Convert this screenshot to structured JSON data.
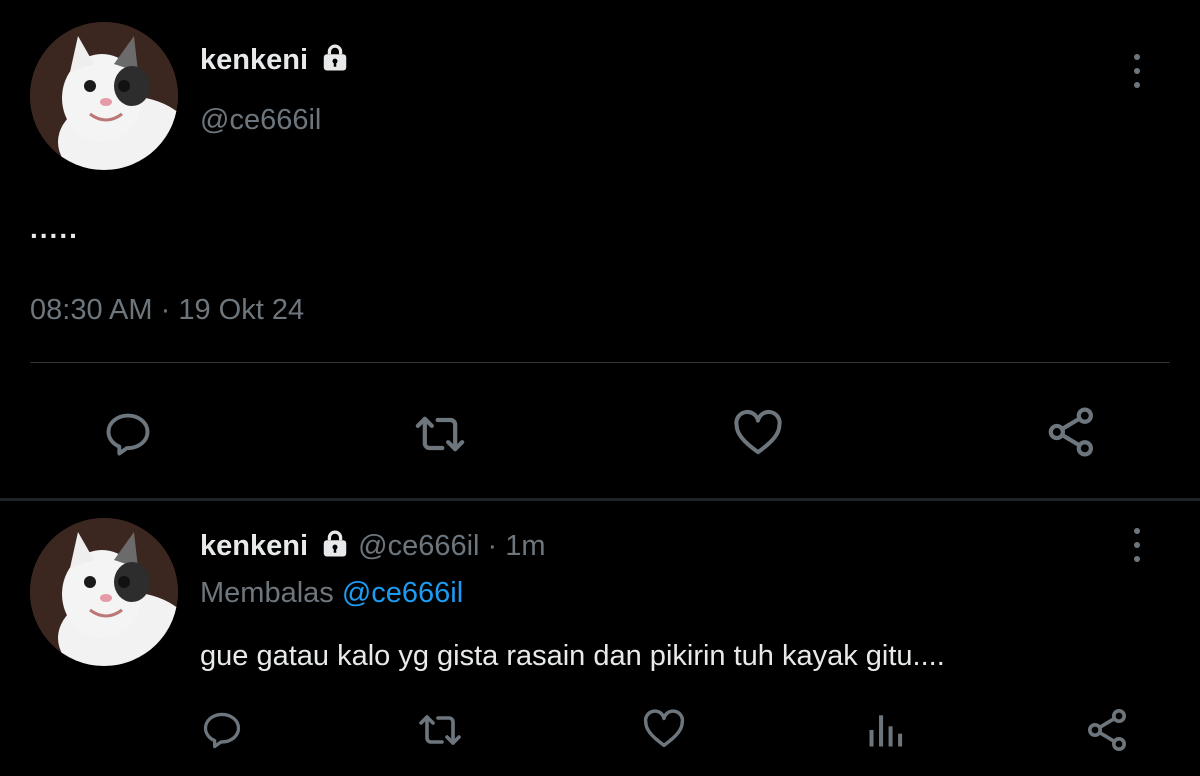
{
  "tweet": {
    "display_name": "kenkeni",
    "handle": "@ce666il",
    "text": ".....",
    "timestamp": "08:30 AM",
    "separator": "·",
    "date": "19 Okt 24",
    "icons": {
      "lock": "lock-icon",
      "more": "more-vertical-icon",
      "reply": "reply-icon",
      "retweet": "retweet-icon",
      "like": "heart-icon",
      "share": "share-icon"
    }
  },
  "reply": {
    "display_name": "kenkeni",
    "handle": "@ce666il",
    "separator": "·",
    "age": "1m",
    "replying_prefix": "Membalas",
    "replying_to": "@ce666il",
    "text": "gue gatau kalo yg gista rasain dan pikirin tuh kayak gitu....",
    "icons": {
      "lock": "lock-icon",
      "more": "more-vertical-icon",
      "reply": "reply-icon",
      "retweet": "retweet-icon",
      "like": "heart-icon",
      "analytics": "analytics-icon",
      "share": "share-icon"
    }
  },
  "colors": {
    "background": "#000000",
    "text": "#e7e9ea",
    "muted": "#6e767d",
    "link": "#1d9bf0",
    "divider": "#2f3336"
  }
}
